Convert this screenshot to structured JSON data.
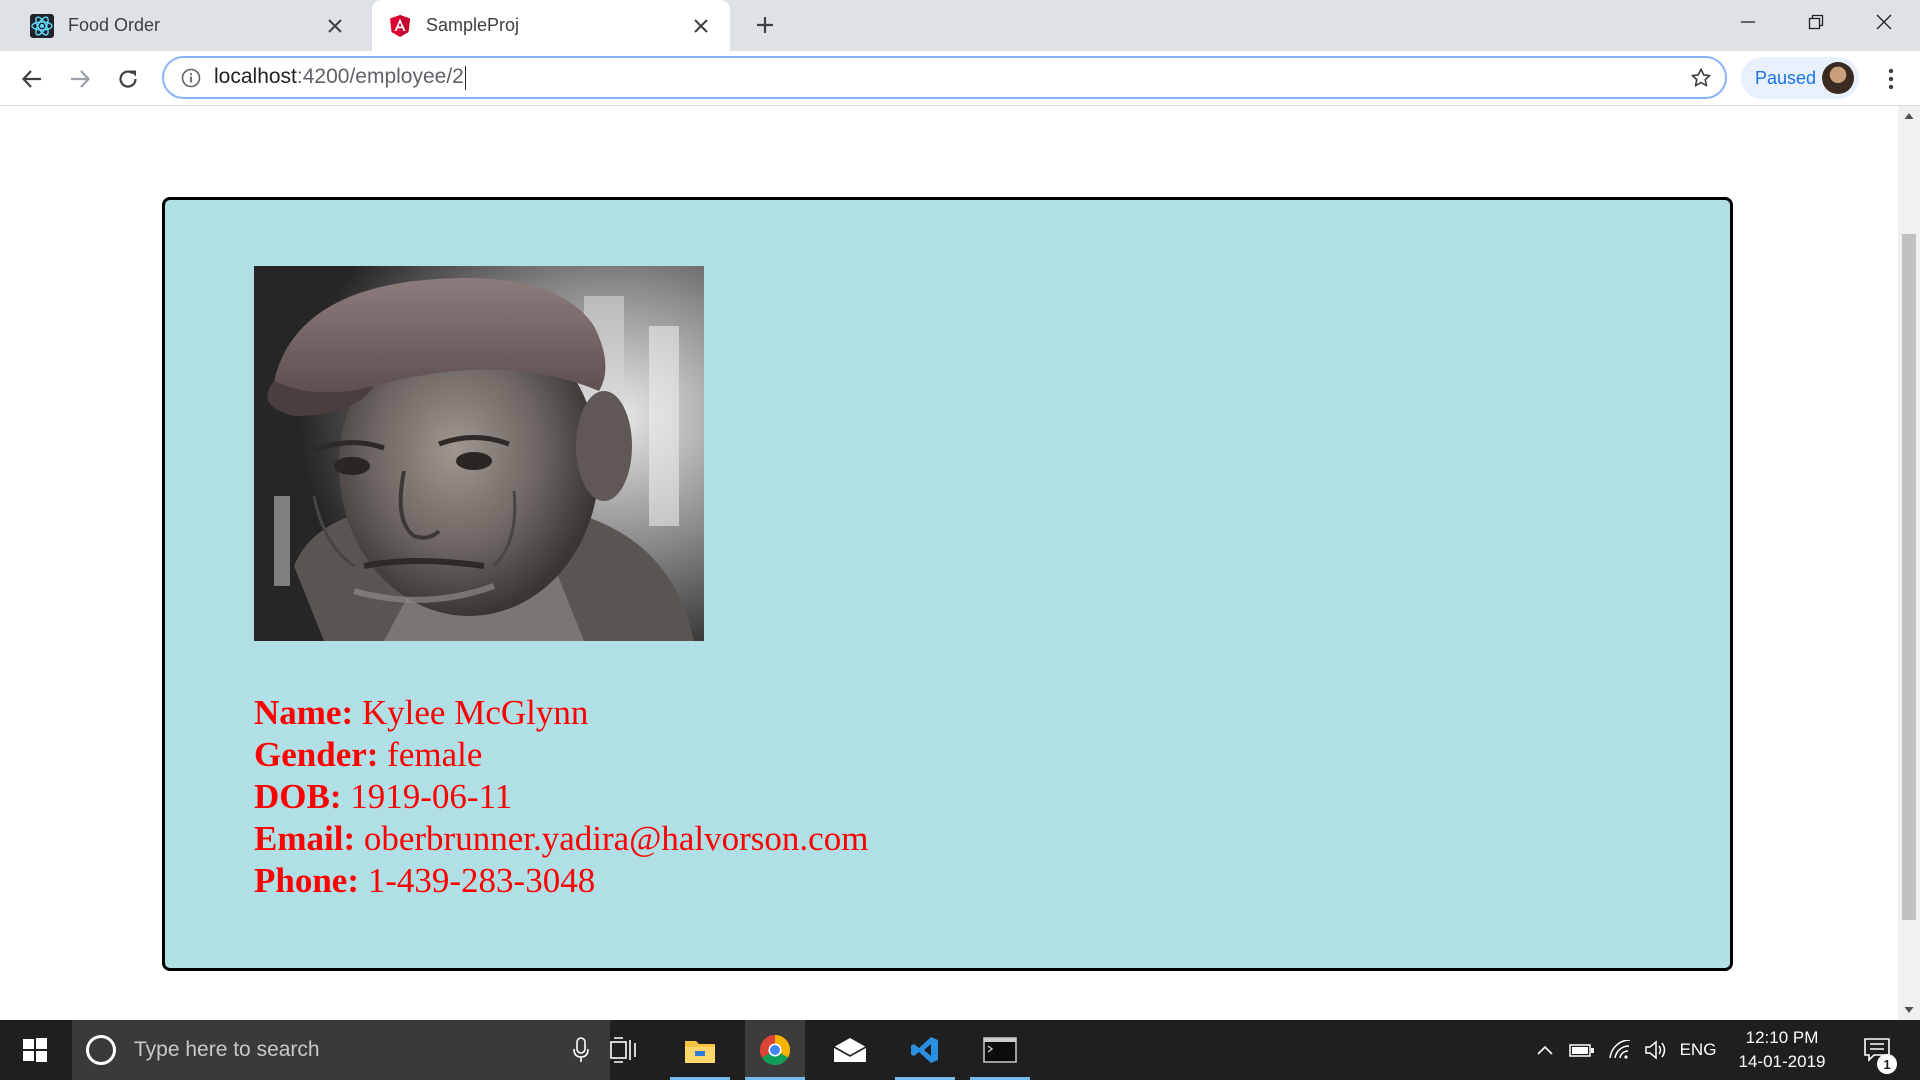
{
  "browser": {
    "tabs": [
      {
        "title": "Food Order",
        "icon": "react-icon",
        "active": false
      },
      {
        "title": "SampleProj",
        "icon": "angular-icon",
        "active": true
      }
    ],
    "address": {
      "host": "localhost",
      "path": ":4200/employee/2"
    },
    "profile_label": "Paused"
  },
  "employee": {
    "photo_alt": "employee-photo",
    "fields": [
      {
        "label": "Name:",
        "value": "Kylee McGlynn"
      },
      {
        "label": "Gender:",
        "value": "female"
      },
      {
        "label": "DOB:",
        "value": "1919-06-11"
      },
      {
        "label": "Email:",
        "value": "oberbrunner.yadira@halvorson.com"
      },
      {
        "label": "Phone:",
        "value": "1-439-283-3048"
      }
    ]
  },
  "taskbar": {
    "search_placeholder": "Type here to search",
    "pinned_apps": [
      "task-view-icon",
      "file-explorer-icon",
      "chrome-icon",
      "mail-icon",
      "vscode-icon",
      "terminal-icon"
    ],
    "language": "ENG",
    "time": "12:10 PM",
    "date": "14-01-2019",
    "notification_count": "1"
  },
  "colors": {
    "card_background": "#b0dfe5",
    "detail_text": "#ff0000",
    "tabstrip": "#dee1e6",
    "taskbar": "#1f1f1f"
  }
}
